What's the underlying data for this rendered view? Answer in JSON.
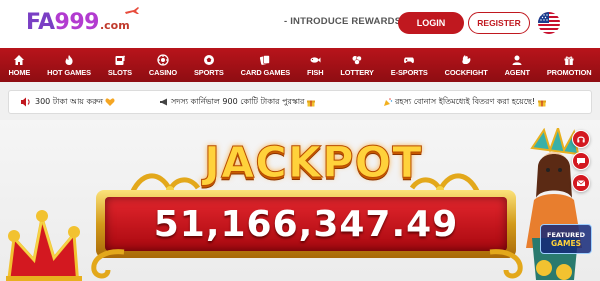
{
  "header": {
    "logo": {
      "fa": "FA",
      "num": "999",
      "com": ".com"
    },
    "intro_label": "- INTRODUCE REWARDS",
    "login_label": "LOGIN",
    "register_label": "REGISTER",
    "language_icon": "us-flag-icon"
  },
  "nav": {
    "items": [
      {
        "label": "HOME",
        "icon": "home-icon"
      },
      {
        "label": "HOT GAMES",
        "icon": "fire-icon"
      },
      {
        "label": "SLOTS",
        "icon": "slots-icon"
      },
      {
        "label": "CASINO",
        "icon": "casino-icon"
      },
      {
        "label": "SPORTS",
        "icon": "sports-icon"
      },
      {
        "label": "CARD GAMES",
        "icon": "cards-icon"
      },
      {
        "label": "FISH",
        "icon": "fish-icon"
      },
      {
        "label": "LOTTERY",
        "icon": "lottery-icon"
      },
      {
        "label": "E-SPORTS",
        "icon": "gamepad-icon"
      },
      {
        "label": "COCKFIGHT",
        "icon": "rooster-icon"
      },
      {
        "label": "AGENT",
        "icon": "agent-icon"
      },
      {
        "label": "PROMOTION",
        "icon": "gift-icon"
      }
    ]
  },
  "marquee": {
    "msg1": "300 টাকা আয় করুন",
    "msg2": "সদস্য কার্নিভাল 900 কোটি টাকার পুরস্কার",
    "msg3": "রহস্য বোনাস ইতিমধ্যেই বিতরণ করা হয়েছে!"
  },
  "banner": {
    "title": "JACKPOT",
    "amount": "51,166,347.49",
    "featured_label_1": "FEATURED",
    "featured_label_2": "GAMES"
  },
  "colors": {
    "brand_red": "#c0181f",
    "nav_red": "#a8121a",
    "gold": "#ffd23b",
    "logo_purple": "#7a3fc4"
  }
}
